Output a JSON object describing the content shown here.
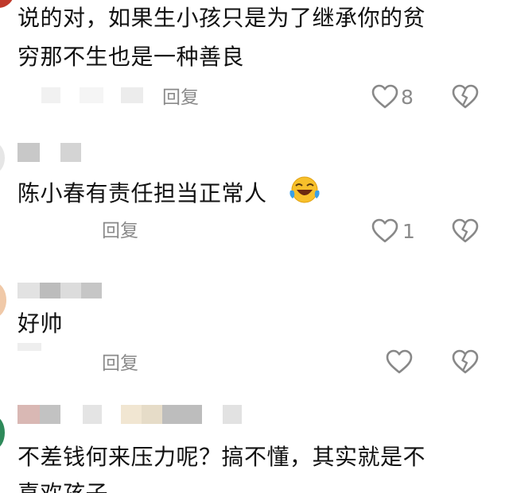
{
  "comments": [
    {
      "text_line1": "说的对，如果生小孩只是为了继承你的贫",
      "text_line2": "穷那不生也是一种善良",
      "reply_label": "回复",
      "like_count": "8"
    },
    {
      "text": "陈小春有责任担当正常人",
      "reply_label": "回复",
      "like_count": "1"
    },
    {
      "text": "好帅",
      "reply_label": "回复",
      "like_count": ""
    },
    {
      "text_line1": "不差钱何来压力呢？搞不懂，其实就是不",
      "text_line2": "喜欢孩子"
    }
  ],
  "icons": {
    "like": "heart-outline-icon",
    "dislike": "broken-heart-icon",
    "emoji": "laughing-tears-emoji-icon"
  },
  "colors": {
    "text": "#111111",
    "secondary": "#8a8a8a",
    "icon_stroke": "#888888"
  }
}
